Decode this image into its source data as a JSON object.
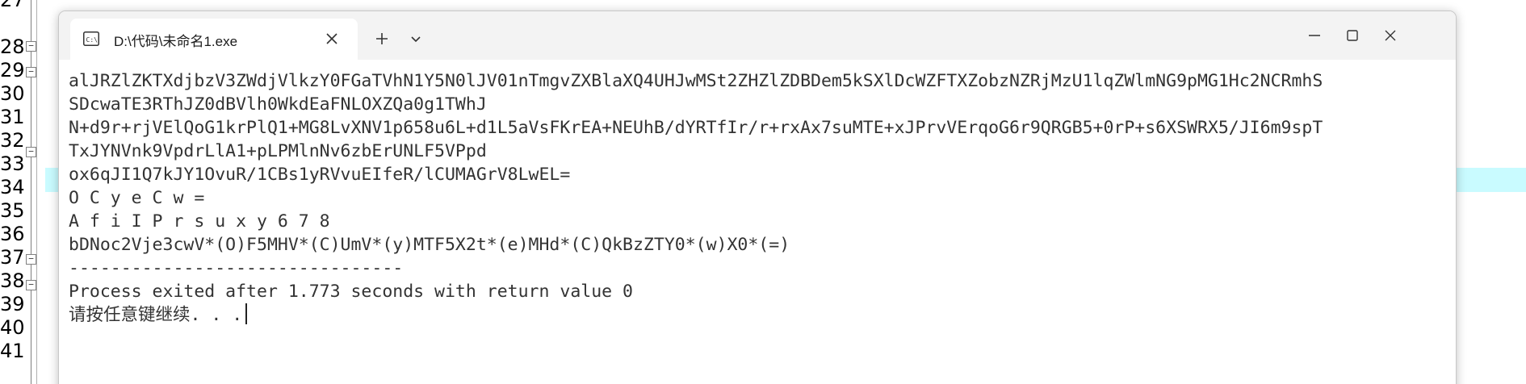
{
  "editor": {
    "line_numbers": [
      "27",
      "28",
      "29",
      "30",
      "31",
      "32",
      "33",
      "34",
      "35",
      "36",
      "37",
      "38",
      "39",
      "40",
      "41"
    ],
    "fold_markers": [
      "−",
      "−",
      "−",
      "−",
      "−",
      "−"
    ],
    "highlight_color": "#c9fbff"
  },
  "window": {
    "tab_title": "D:\\代码\\未命名1.exe",
    "icons": {
      "terminal": "terminal-icon",
      "close_tab": "close-icon",
      "new_tab": "plus-icon",
      "dropdown": "chevron-down-icon",
      "minimize": "minimize-icon",
      "maximize": "maximize-icon",
      "close_window": "close-icon"
    }
  },
  "console": {
    "lines": [
      "alJRZlZKTXdjbzV3ZWdjVlkzY0FGaTVhN1Y5N0lJV01nTmgvZXBlaXQ4UHJwMSt2ZHZlZDBDem5kSXlDcWZFTXZobzNZRjMzU1lqZWlmNG9pMG1Hc2NCRmhS",
      "SDcwaTE3RThJZ0dBVlh0WkdEaFNLOXZQa0g1TWhJ",
      "N+d9r+rjVElQoG1krPlQ1+MG8LvXNV1p658u6L+d1L5aVsFKrEA+NEUhB/dYRTfIr/r+rxAx7suMTE+xJPrvVErqoG6r9QRGB5+0rP+s6XSWRX5/JI6m9spT",
      "TxJYNVnk9VpdrLlA1+pLPMlnNv6zbErUNLF5VPpd",
      "ox6qJI1Q7kJY1OvuR/1CBs1yRVvuEIfeR/lCUMAGrV8LwEL=",
      "O C y e C w =",
      "A f i I P r s u x y 6 7 8",
      "bDNoc2Vje3cwV*(O)F5MHV*(C)UmV*(y)MTF5X2t*(e)MHd*(C)QkBzZTY0*(w)X0*(=)",
      "--------------------------------",
      "Process exited after 1.773 seconds with return value 0",
      "请按任意键继续. . ."
    ]
  }
}
